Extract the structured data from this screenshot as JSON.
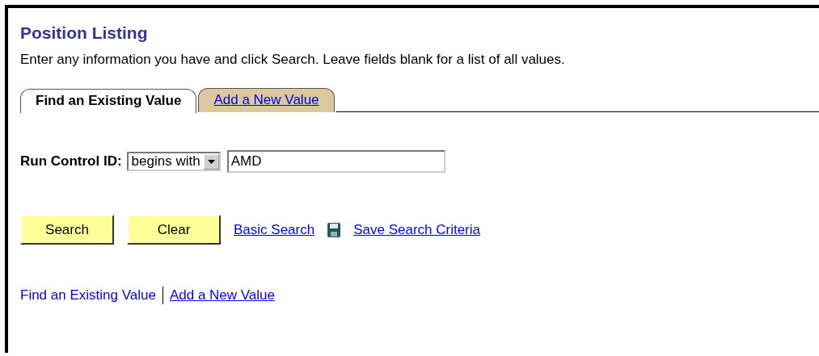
{
  "title": "Position Listing",
  "instructions": "Enter any information you have and click Search. Leave fields blank for a list of all values.",
  "tabs": [
    {
      "label": "Find an Existing Value",
      "selected": true
    },
    {
      "label": "Add a New Value",
      "selected": false
    }
  ],
  "criteria": {
    "label": "Run Control ID:",
    "operator": "begins with",
    "value": "AMD"
  },
  "buttons": [
    "Search",
    "Clear"
  ],
  "links": [
    "Basic Search",
    "Save Search Criteria"
  ],
  "footer_links": [
    {
      "label": "Find an Existing Value",
      "selected": true
    },
    {
      "label": "Add a New Value",
      "selected": false
    }
  ]
}
